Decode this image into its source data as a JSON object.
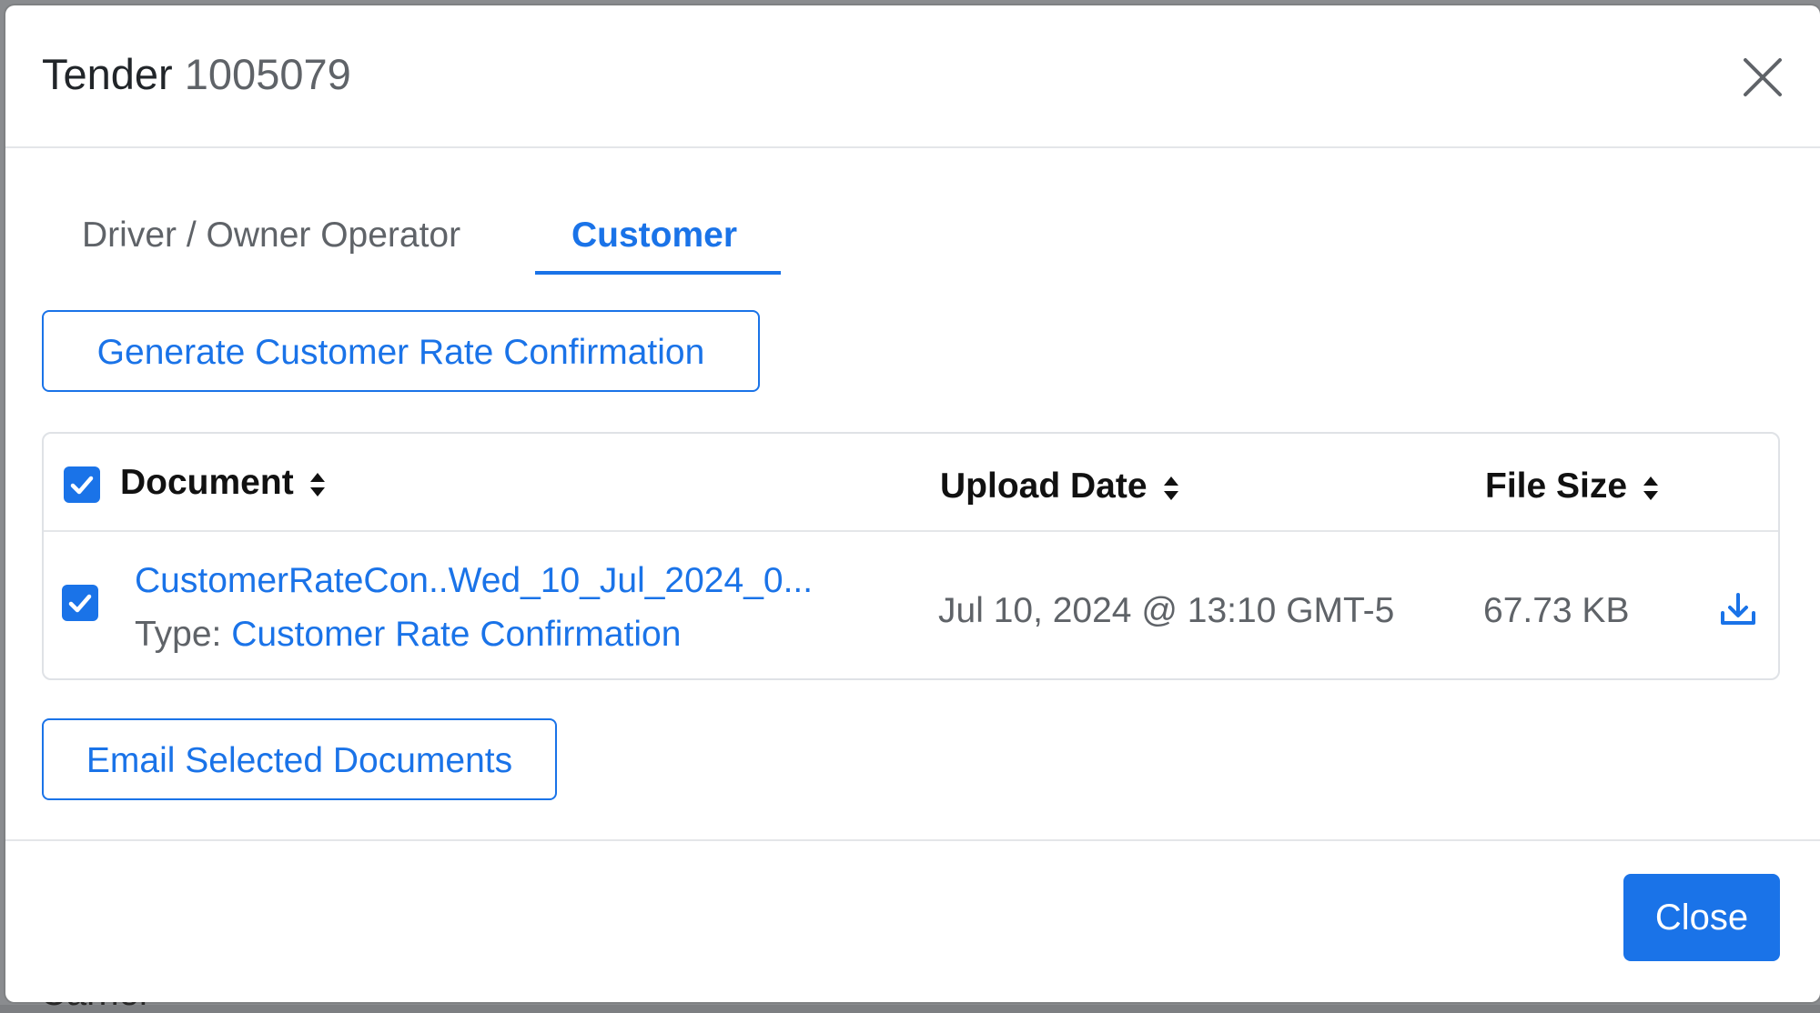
{
  "background": {
    "partial_text": "Carrier"
  },
  "modal": {
    "title": "Tender",
    "tender_number": "1005079"
  },
  "tabs": [
    {
      "label": "Driver / Owner Operator",
      "active": false
    },
    {
      "label": "Customer",
      "active": true
    }
  ],
  "actions": {
    "generate_label": "Generate Customer Rate Confirmation",
    "email_label": "Email Selected Documents"
  },
  "table": {
    "columns": {
      "document": "Document",
      "upload_date": "Upload Date",
      "file_size": "File Size"
    },
    "rows": [
      {
        "checked": true,
        "document_name": "CustomerRateCon..Wed_10_Jul_2024_0...",
        "type_label": "Type:",
        "type_value": "Customer Rate Confirmation",
        "upload_date": "Jul 10, 2024 @ 13:10 GMT-5",
        "file_size": "67.73 KB"
      }
    ],
    "select_all_checked": true
  },
  "footer": {
    "close_label": "Close"
  },
  "icons": {
    "close": "close-icon",
    "sort": "sort-icon",
    "download": "download-icon",
    "check": "check-icon"
  },
  "colors": {
    "accent": "#1a73e8",
    "text_muted": "#5f6368",
    "text_dark": "#212529"
  }
}
